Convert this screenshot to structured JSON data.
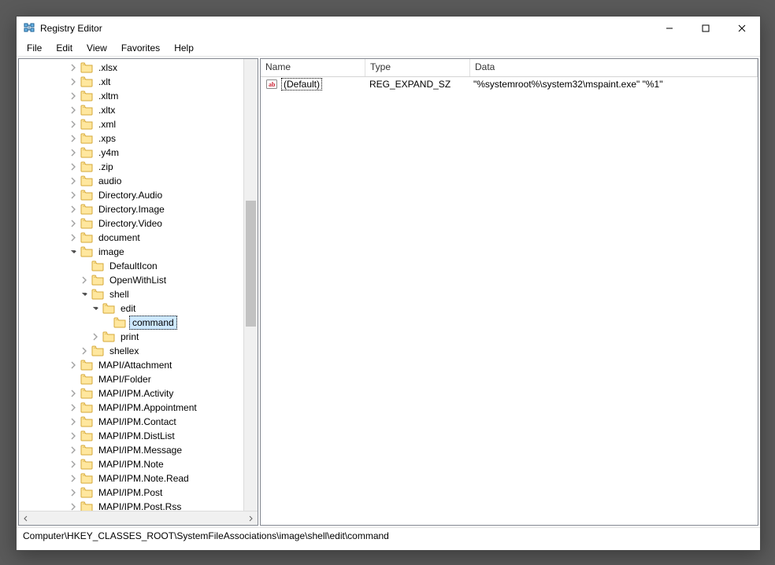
{
  "window": {
    "title": "Registry Editor"
  },
  "menubar": [
    "File",
    "Edit",
    "View",
    "Favorites",
    "Help"
  ],
  "tree": [
    {
      "depth": 5,
      "exp": "c",
      "label": ".xlsx"
    },
    {
      "depth": 5,
      "exp": "c",
      "label": ".xlt"
    },
    {
      "depth": 5,
      "exp": "c",
      "label": ".xltm"
    },
    {
      "depth": 5,
      "exp": "c",
      "label": ".xltx"
    },
    {
      "depth": 5,
      "exp": "c",
      "label": ".xml"
    },
    {
      "depth": 5,
      "exp": "c",
      "label": ".xps"
    },
    {
      "depth": 5,
      "exp": "c",
      "label": ".y4m"
    },
    {
      "depth": 5,
      "exp": "c",
      "label": ".zip"
    },
    {
      "depth": 5,
      "exp": "c",
      "label": "audio"
    },
    {
      "depth": 5,
      "exp": "c",
      "label": "Directory.Audio"
    },
    {
      "depth": 5,
      "exp": "c",
      "label": "Directory.Image"
    },
    {
      "depth": 5,
      "exp": "c",
      "label": "Directory.Video"
    },
    {
      "depth": 5,
      "exp": "c",
      "label": "document"
    },
    {
      "depth": 5,
      "exp": "o",
      "label": "image"
    },
    {
      "depth": 6,
      "exp": "n",
      "label": "DefaultIcon"
    },
    {
      "depth": 6,
      "exp": "c",
      "label": "OpenWithList"
    },
    {
      "depth": 6,
      "exp": "o",
      "label": "shell"
    },
    {
      "depth": 7,
      "exp": "o",
      "label": "edit"
    },
    {
      "depth": 8,
      "exp": "n",
      "label": "command",
      "selected": true
    },
    {
      "depth": 7,
      "exp": "c",
      "label": "print"
    },
    {
      "depth": 6,
      "exp": "c",
      "label": "shellex"
    },
    {
      "depth": 5,
      "exp": "c",
      "label": "MAPI/Attachment"
    },
    {
      "depth": 5,
      "exp": "n",
      "label": "MAPI/Folder"
    },
    {
      "depth": 5,
      "exp": "c",
      "label": "MAPI/IPM.Activity"
    },
    {
      "depth": 5,
      "exp": "c",
      "label": "MAPI/IPM.Appointment"
    },
    {
      "depth": 5,
      "exp": "c",
      "label": "MAPI/IPM.Contact"
    },
    {
      "depth": 5,
      "exp": "c",
      "label": "MAPI/IPM.DistList"
    },
    {
      "depth": 5,
      "exp": "c",
      "label": "MAPI/IPM.Message"
    },
    {
      "depth": 5,
      "exp": "c",
      "label": "MAPI/IPM.Note"
    },
    {
      "depth": 5,
      "exp": "c",
      "label": "MAPI/IPM.Note.Read"
    },
    {
      "depth": 5,
      "exp": "c",
      "label": "MAPI/IPM.Post"
    },
    {
      "depth": 5,
      "exp": "c",
      "label": "MAPI/IPM.Post.Rss"
    }
  ],
  "columns": {
    "name": "Name",
    "type": "Type",
    "data": "Data",
    "widths": {
      "name": 120,
      "type": 120,
      "data": 380
    }
  },
  "values": [
    {
      "name": "(Default)",
      "type": "REG_EXPAND_SZ",
      "data": "\"%systemroot%\\system32\\mspaint.exe\" \"%1\"",
      "selected": true
    }
  ],
  "statusbar": "Computer\\HKEY_CLASSES_ROOT\\SystemFileAssociations\\image\\shell\\edit\\command"
}
